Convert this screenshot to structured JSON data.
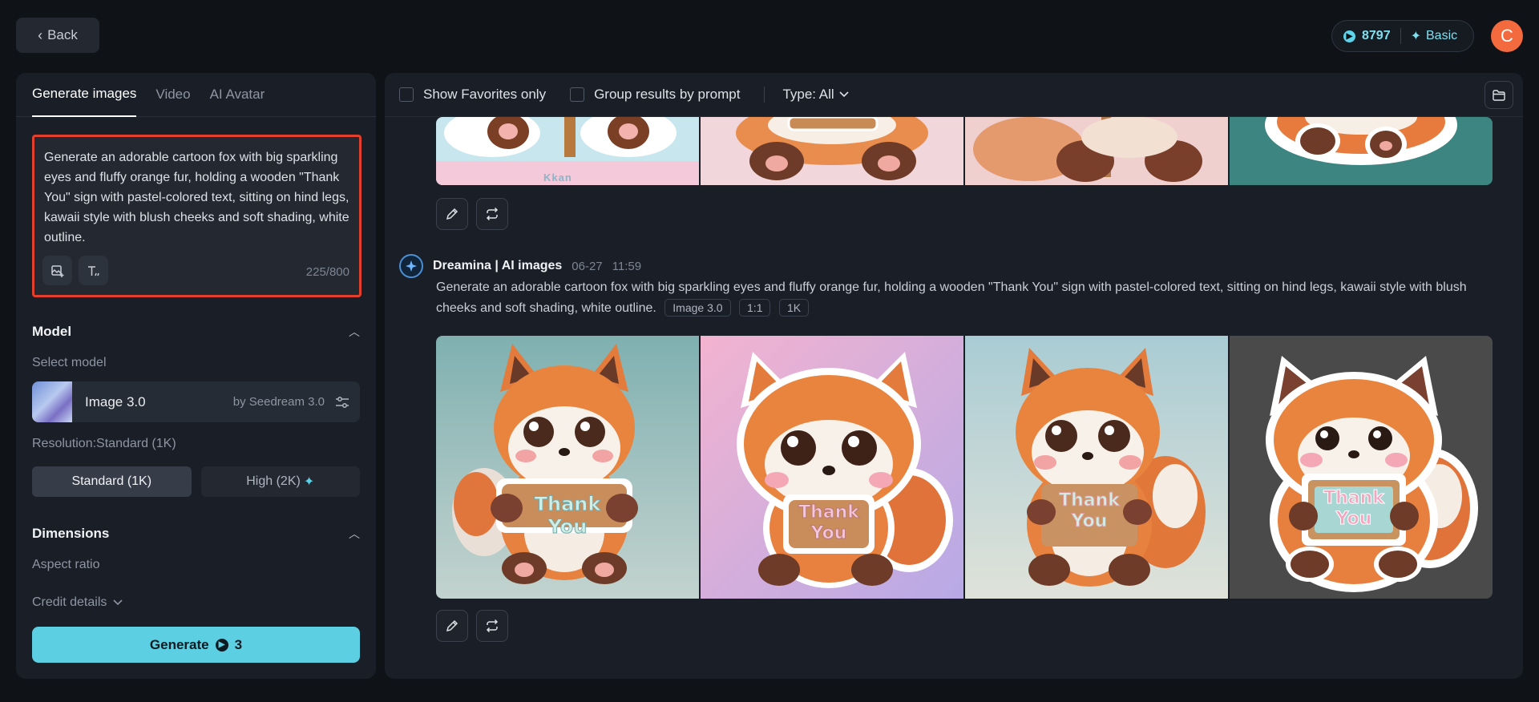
{
  "header": {
    "back_label": "Back",
    "credits": "8797",
    "plan": "Basic",
    "avatar_initial": "C"
  },
  "left": {
    "tabs": [
      {
        "label": "Generate images",
        "active": true
      },
      {
        "label": "Video",
        "active": false
      },
      {
        "label": "AI Avatar",
        "active": false
      }
    ],
    "prompt": "Generate an adorable cartoon fox with big sparkling eyes and fluffy orange fur, holding a wooden \"Thank You\" sign with pastel-colored text, sitting on hind legs, kawaii style with blush cheeks and soft shading, white outline.",
    "char_count": "225/800",
    "model_section": "Model",
    "select_model_label": "Select model",
    "model_name": "Image 3.0",
    "model_by": "by Seedream 3.0",
    "resolution_label": "Resolution:Standard (1K)",
    "res_standard": "Standard (1K)",
    "res_high": "High (2K)",
    "dimensions_section": "Dimensions",
    "aspect_ratio_label": "Aspect ratio",
    "credit_details": "Credit details",
    "generate_label": "Generate",
    "generate_cost": "3"
  },
  "right": {
    "show_favorites": "Show Favorites only",
    "group_results": "Group results by prompt",
    "type_filter": "Type: All",
    "top_row_watermark": "Kkan",
    "generation": {
      "bot_name": "Dreamina | AI images",
      "date": "06-27",
      "time": "11:59",
      "prompt": "Generate an adorable cartoon fox with big sparkling eyes and fluffy orange fur, holding a wooden \"Thank You\" sign with pastel-colored text, sitting on hind legs, kawaii style with blush cheeks and soft shading, white outline.",
      "chips": [
        "Image 3.0",
        "1:1",
        "1K"
      ],
      "sign_texts": [
        "Thank You",
        "Thank You",
        "Thank You",
        "Thank You"
      ]
    }
  },
  "colors": {
    "accent": "#5ccfe2",
    "highlight_border": "#e0402c",
    "avatar": "#f26a3d"
  }
}
